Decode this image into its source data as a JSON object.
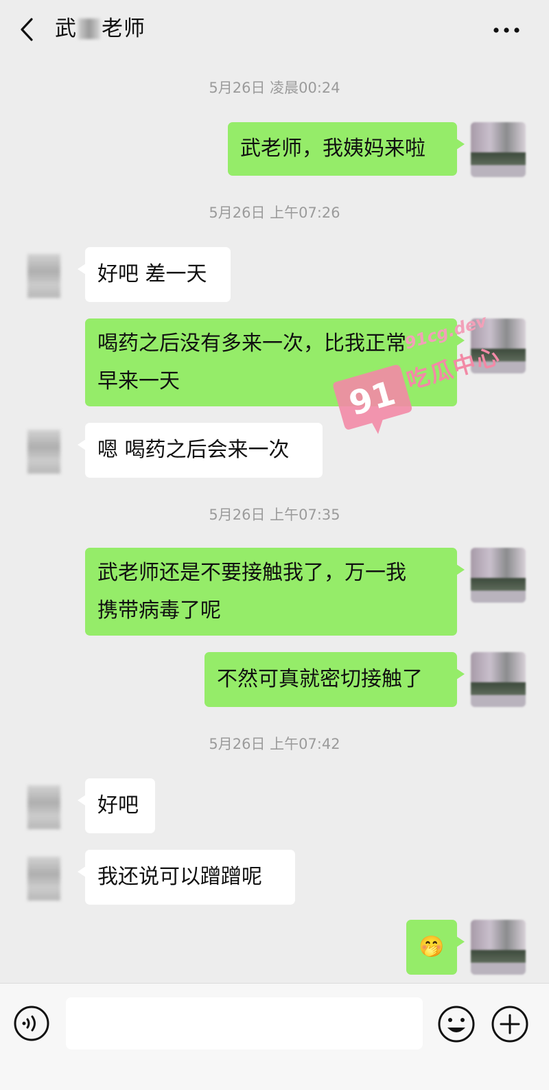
{
  "header": {
    "title_prefix": "武",
    "title_suffix": "老师"
  },
  "messages": [
    {
      "kind": "time",
      "text": "5月26日 凌晨00:24"
    },
    {
      "kind": "me",
      "text": "武老师，我姨妈来啦"
    },
    {
      "kind": "time",
      "text": "5月26日 上午07:26"
    },
    {
      "kind": "other",
      "text": "好吧 差一天"
    },
    {
      "kind": "me",
      "text": "喝药之后没有多来一次，比我正常\n早来一天"
    },
    {
      "kind": "other",
      "text": "嗯 喝药之后会来一次"
    },
    {
      "kind": "time",
      "text": "5月26日 上午07:35"
    },
    {
      "kind": "me",
      "text": "武老师还是不要接触我了，万一我\n携带病毒了呢"
    },
    {
      "kind": "me",
      "text": "不然可真就密切接触了"
    },
    {
      "kind": "time",
      "text": "5月26日 上午07:42"
    },
    {
      "kind": "other",
      "text": "好吧"
    },
    {
      "kind": "other",
      "text": "我还说可以蹭蹭呢"
    },
    {
      "kind": "me",
      "text": "🤭"
    }
  ],
  "watermark": {
    "number": "91",
    "text": "吃瓜中心",
    "domain": "91cg.dev"
  },
  "icons": {
    "back": "chevron-left-icon",
    "more": "more-dots-icon",
    "voice": "voice-icon",
    "emoji": "smiley-icon",
    "plus": "plus-icon"
  },
  "colors": {
    "background": "#ededed",
    "bubble_me": "#95ec69",
    "bubble_other": "#ffffff",
    "timestamp": "#9b9b9b",
    "watermark": "#f28aa6"
  }
}
